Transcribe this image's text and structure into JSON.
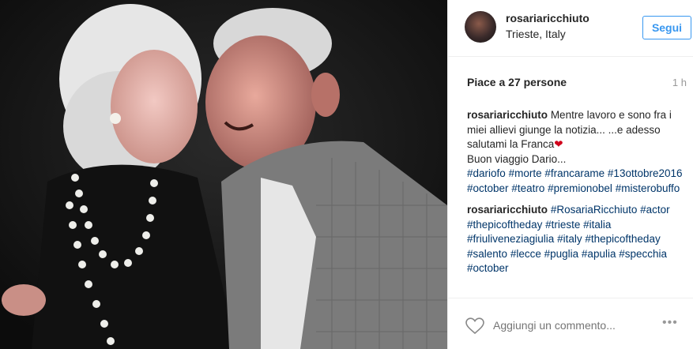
{
  "header": {
    "username": "rosariaricchiuto",
    "location": "Trieste, Italy",
    "follow_label": "Segui"
  },
  "likes": "Piace a 27 persone",
  "time": "1 h",
  "comments": [
    {
      "user": "rosariaricchiuto",
      "text_1": "Mentre lavoro e sono fra i miei allievi giunge la notizia... ...e adesso salutami la Franca",
      "emoji": "❤",
      "text_2": "Buon viaggio Dario...",
      "tags": [
        "#dariofo",
        "#morte",
        "#francarame",
        "#13ottobre2016",
        "#october",
        "#teatro",
        "#premionobel",
        "#misterobuffo"
      ]
    },
    {
      "user": "rosariaricchiuto",
      "tags": [
        "#RosariaRicchiuto",
        "#actor",
        "#thepicoftheday",
        "#trieste",
        "#italia",
        "#friuliveneziagiulia",
        "#italy",
        "#thepicoftheday",
        "#salento",
        "#lecce",
        "#puglia",
        "#apulia",
        "#specchia",
        "#october"
      ]
    }
  ],
  "footer": {
    "comment_placeholder": "Aggiungi un commento...",
    "more_label": "•••",
    "heart_icon": "heart-outline-icon"
  },
  "colors": {
    "accent": "#3897f0",
    "hashtag": "#003569",
    "muted": "#999999"
  }
}
